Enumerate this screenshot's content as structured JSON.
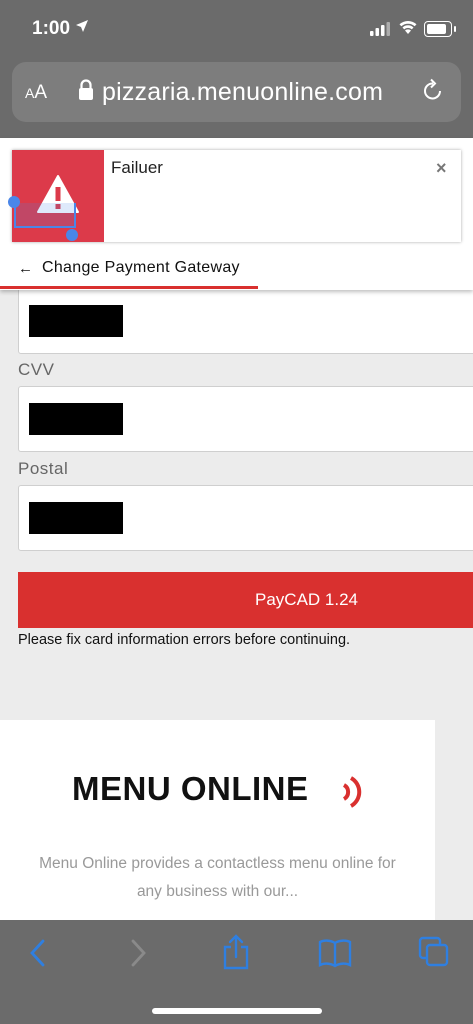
{
  "status_bar": {
    "time": "1:00"
  },
  "browser": {
    "aa_small": "A",
    "aa_large": "A",
    "url": "pizzaria.menuonline.com"
  },
  "toast": {
    "title": "Failuer",
    "close": "×"
  },
  "nav": {
    "back_arrow": "←",
    "back_label": "Change Payment Gateway"
  },
  "form": {
    "labels": {
      "cvv": "CVV",
      "postal": "Postal"
    },
    "pay_label": "PayCAD 1.24",
    "error_message": "Please fix card information errors before continuing."
  },
  "footer": {
    "brand": "MENU ONLINE",
    "tagline_line1": "Menu Online provides a contactless menu online for",
    "tagline_line2": "any business with our..."
  },
  "colors": {
    "accent": "#d9302f",
    "toast_icon_bg": "#dc3a4a",
    "ios_blue": "#2f7fe0"
  }
}
